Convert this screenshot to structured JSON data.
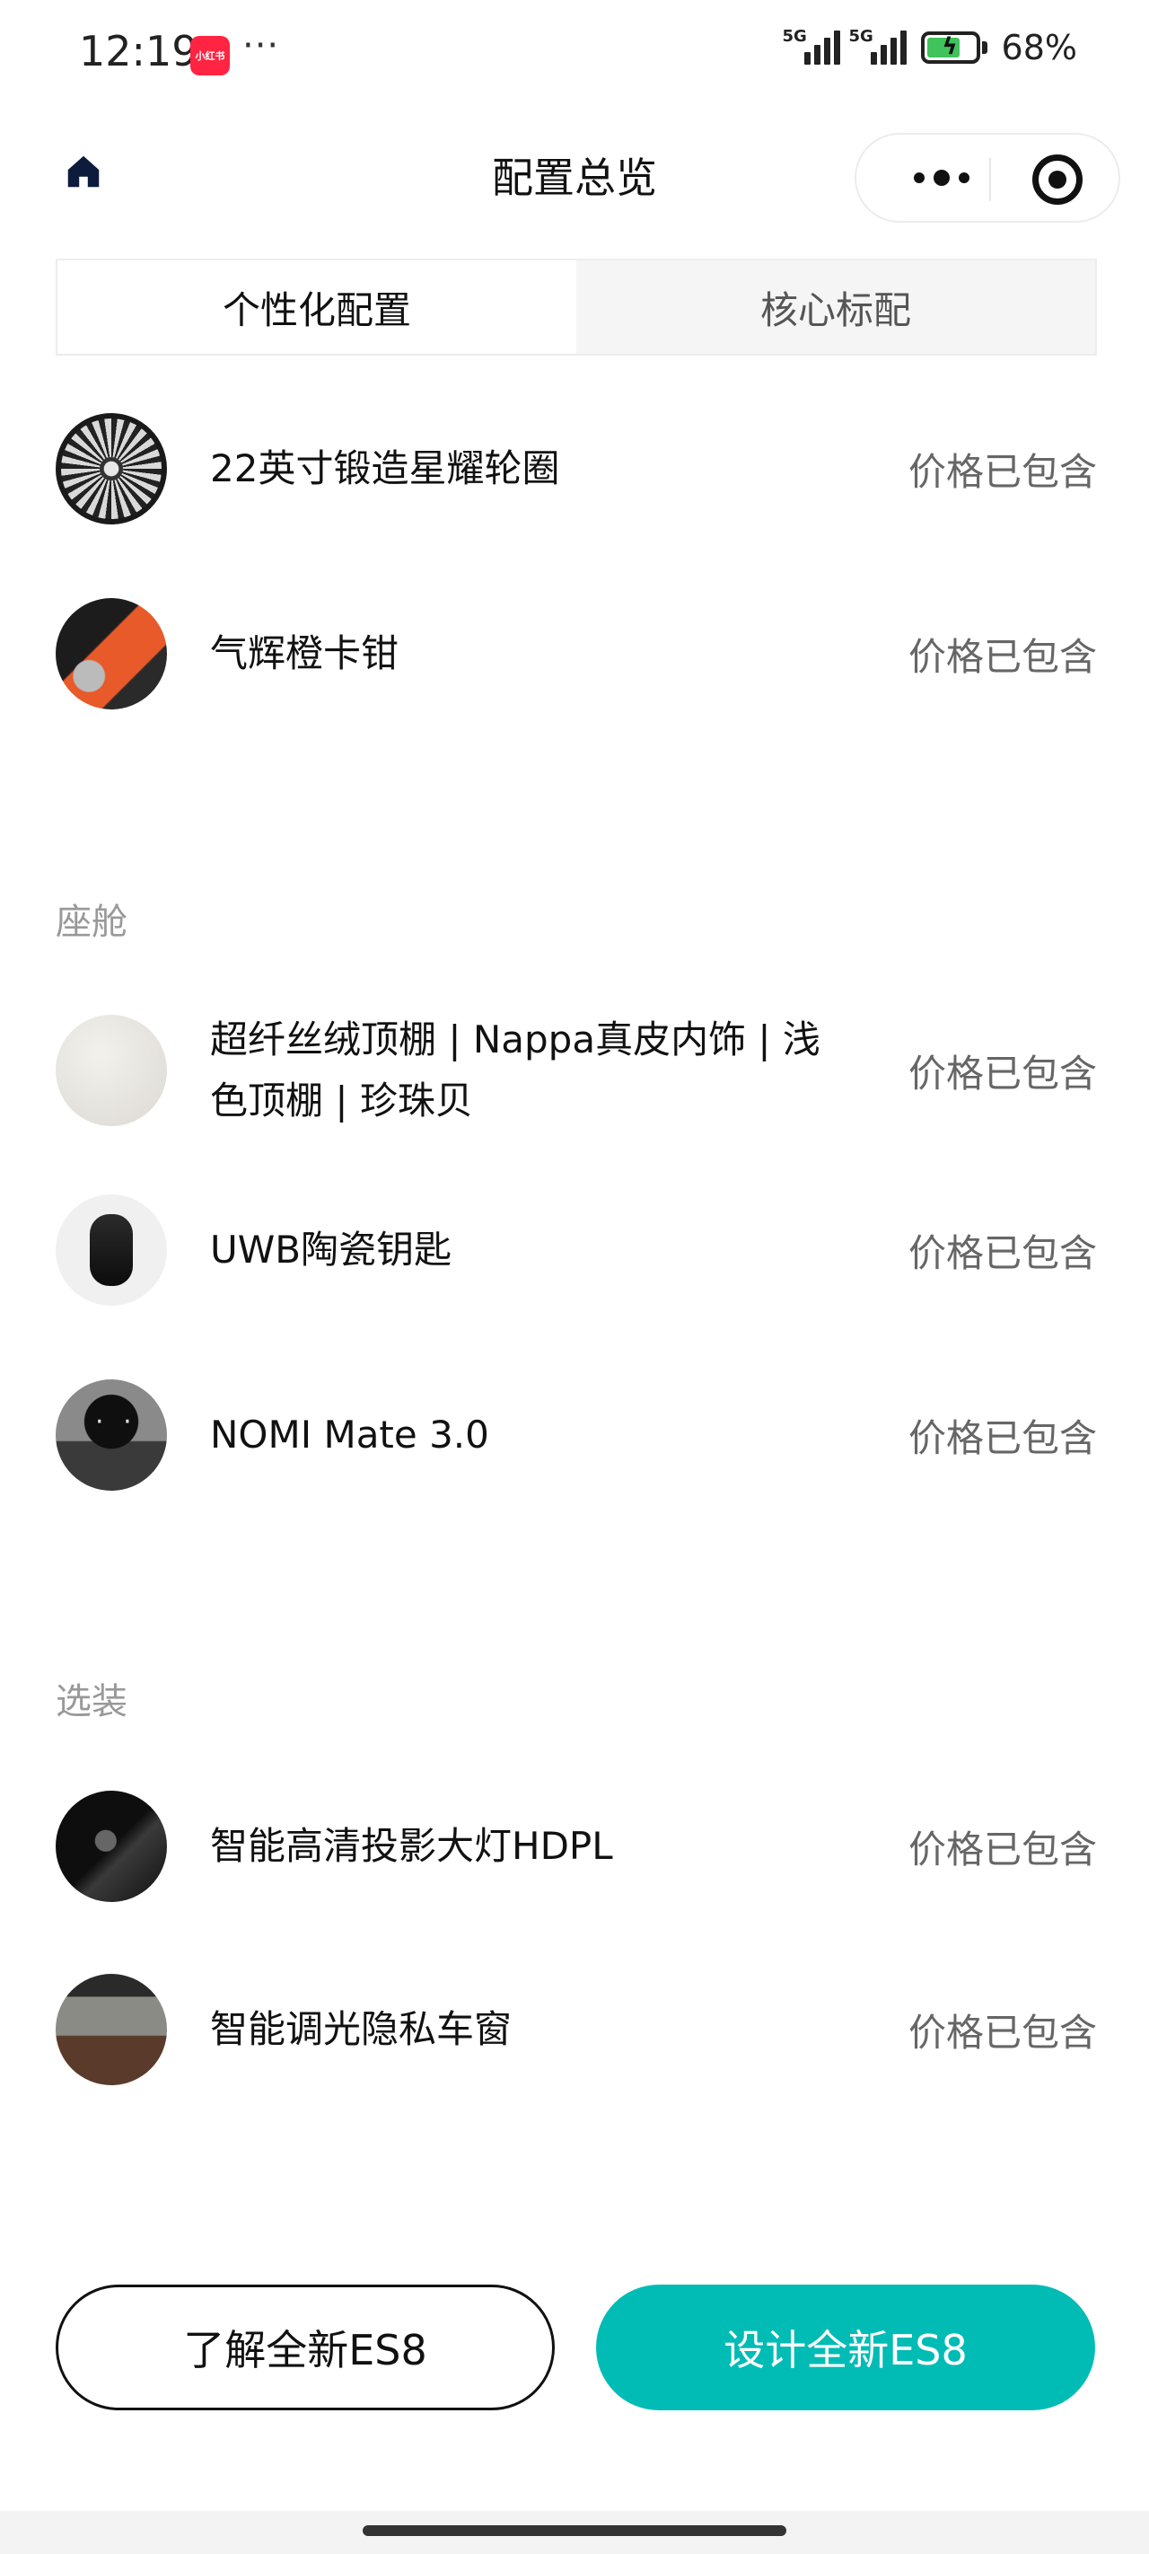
{
  "status_bar": {
    "time": "12:19",
    "app_badge": "小红书",
    "more_dots": "···",
    "signal_1": "5G",
    "signal_2": "5G",
    "battery": "68%"
  },
  "nav": {
    "title": "配置总览",
    "icons": [
      "home-icon",
      "more-icon",
      "target-icon"
    ]
  },
  "tabs": [
    {
      "label": "个性化配置",
      "active": true
    },
    {
      "label": "核心标配",
      "active": false
    }
  ],
  "items_top": [
    {
      "label": "22英寸锻造星耀轮圈",
      "price": "价格已包含",
      "thumb": "wheel"
    },
    {
      "label": "气辉橙卡钳",
      "price": "价格已包含",
      "thumb": "caliper"
    }
  ],
  "section_cabin": {
    "title": "座舱",
    "items": [
      {
        "label": "超纤丝绒顶棚 | Nappa真皮内饰 | 浅色顶棚 | 珍珠贝",
        "price": "价格已包含",
        "thumb": "roof"
      },
      {
        "label": "UWB陶瓷钥匙",
        "price": "价格已包含",
        "thumb": "key"
      },
      {
        "label": "NOMI Mate 3.0",
        "price": "价格已包含",
        "thumb": "nomi"
      }
    ]
  },
  "section_options": {
    "title": "选装",
    "items": [
      {
        "label": "智能高清投影大灯HDPL",
        "price": "价格已包含",
        "thumb": "headlight"
      },
      {
        "label": "智能调光隐私车窗",
        "price": "价格已包含",
        "thumb": "window"
      }
    ]
  },
  "buttons": {
    "learn": "了解全新ES8",
    "design": "设计全新ES8"
  },
  "colors": {
    "accent": "#00bcb5",
    "text": "#111111",
    "muted": "#999999"
  }
}
